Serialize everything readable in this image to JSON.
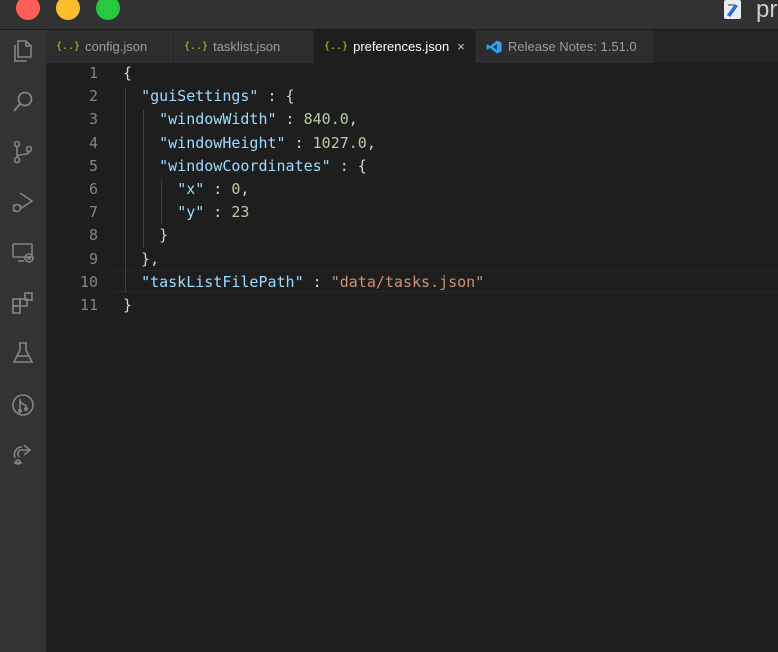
{
  "window": {
    "title_fragment": "pr"
  },
  "tabs": [
    {
      "label": "config.json",
      "icon": "{..}"
    },
    {
      "label": "tasklist.json",
      "icon": "{..}"
    },
    {
      "label": "preferences.json",
      "icon": "{..}",
      "close": "×"
    },
    {
      "label": "Release Notes: 1.51.0"
    }
  ],
  "activity_icons": [
    "explorer-icon",
    "search-icon",
    "source-control-icon",
    "run-debug-icon",
    "remote-explorer-icon",
    "extensions-icon",
    "testing-icon",
    "git-graph-icon",
    "live-share-icon"
  ],
  "editor": {
    "lines": [
      {
        "n": "1",
        "tokens": [
          {
            "t": "{",
            "c": "p"
          }
        ]
      },
      {
        "n": "2",
        "tokens": [
          {
            "t": "  ",
            "c": "p"
          },
          {
            "t": "\"guiSettings\"",
            "c": "k"
          },
          {
            "t": " : {",
            "c": "p"
          }
        ]
      },
      {
        "n": "3",
        "tokens": [
          {
            "t": "    ",
            "c": "p"
          },
          {
            "t": "\"windowWidth\"",
            "c": "k"
          },
          {
            "t": " : ",
            "c": "p"
          },
          {
            "t": "840.0",
            "c": "n"
          },
          {
            "t": ",",
            "c": "p"
          }
        ]
      },
      {
        "n": "4",
        "tokens": [
          {
            "t": "    ",
            "c": "p"
          },
          {
            "t": "\"windowHeight\"",
            "c": "k"
          },
          {
            "t": " : ",
            "c": "p"
          },
          {
            "t": "1027.0",
            "c": "n"
          },
          {
            "t": ",",
            "c": "p"
          }
        ]
      },
      {
        "n": "5",
        "tokens": [
          {
            "t": "    ",
            "c": "p"
          },
          {
            "t": "\"windowCoordinates\"",
            "c": "k"
          },
          {
            "t": " : {",
            "c": "p"
          }
        ]
      },
      {
        "n": "6",
        "tokens": [
          {
            "t": "      ",
            "c": "p"
          },
          {
            "t": "\"x\"",
            "c": "k"
          },
          {
            "t": " : ",
            "c": "p"
          },
          {
            "t": "0",
            "c": "n"
          },
          {
            "t": ",",
            "c": "p"
          }
        ]
      },
      {
        "n": "7",
        "tokens": [
          {
            "t": "      ",
            "c": "p"
          },
          {
            "t": "\"y\"",
            "c": "k"
          },
          {
            "t": " : ",
            "c": "p"
          },
          {
            "t": "23",
            "c": "n"
          }
        ]
      },
      {
        "n": "8",
        "tokens": [
          {
            "t": "    }",
            "c": "p"
          }
        ]
      },
      {
        "n": "9",
        "tokens": [
          {
            "t": "  },",
            "c": "p"
          }
        ]
      },
      {
        "n": "10",
        "tokens": [
          {
            "t": "  ",
            "c": "p"
          },
          {
            "t": "\"taskListFilePath\"",
            "c": "k"
          },
          {
            "t": " : ",
            "c": "p"
          },
          {
            "t": "\"data/tasks.json\"",
            "c": "s"
          }
        ]
      },
      {
        "n": "11",
        "tokens": [
          {
            "t": "}",
            "c": "p"
          }
        ]
      }
    ]
  },
  "colors": {
    "key": "#9cdcfe",
    "number": "#b5cea8",
    "string": "#ce9178",
    "punctuation": "#d4d4d4",
    "json_icon": "#cbcb41",
    "vscode_blue": "#23a9f2"
  }
}
